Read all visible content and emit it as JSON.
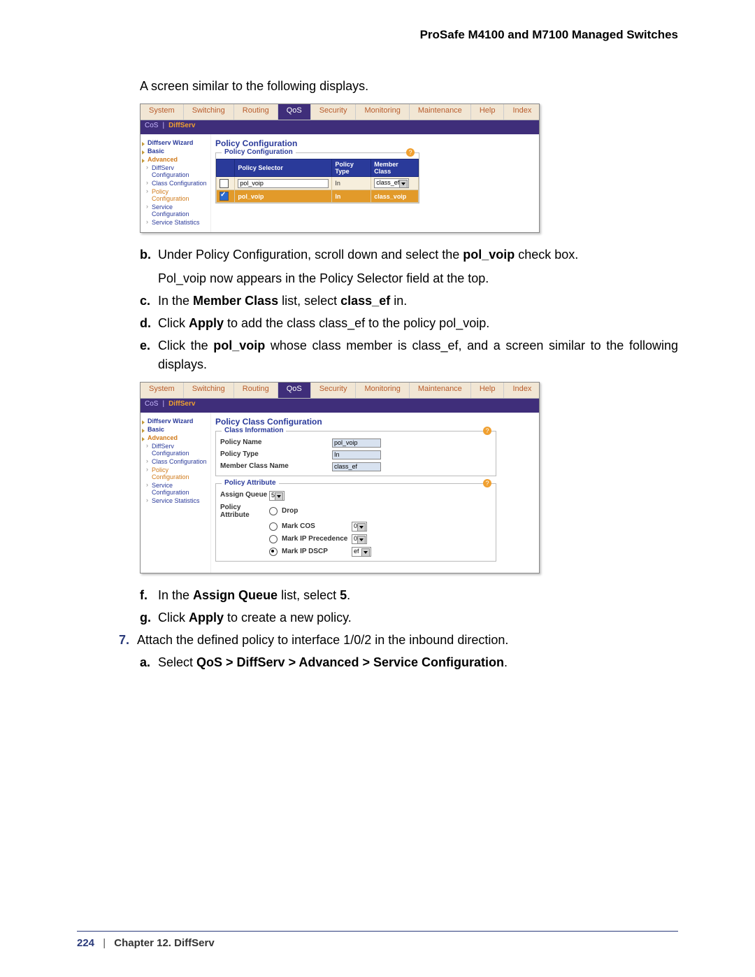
{
  "header_title": "ProSafe M4100 and M7100 Managed Switches",
  "intro_text": "A screen similar to the following displays.",
  "tabs": [
    "System",
    "Switching",
    "Routing",
    "QoS",
    "Security",
    "Monitoring",
    "Maintenance",
    "Help",
    "Index"
  ],
  "active_tab": "QoS",
  "subtabs": [
    "CoS",
    "DiffServ"
  ],
  "active_subtab": "DiffServ",
  "sidebar": {
    "items": [
      "Diffserv Wizard",
      "Basic",
      "Advanced"
    ],
    "sub_items": [
      "DiffServ Configuration",
      "Class Configuration",
      "Policy Configuration",
      "Service Configuration",
      "Service Statistics"
    ]
  },
  "shot1": {
    "panel_title": "Policy Configuration",
    "box_legend": "Policy Configuration",
    "headers": [
      "",
      "Policy Selector",
      "Policy Type",
      "Member Class"
    ],
    "row_input": {
      "policy_selector": "pol_voip",
      "policy_type": "In",
      "member_class": "class_ef"
    },
    "row_selected": {
      "policy_selector": "pol_voip",
      "policy_type": "In",
      "member_class": "class_voip"
    }
  },
  "steps_b_to_e": {
    "b1": "Under Policy Configuration, scroll down and select the ",
    "b1_bold": "pol_voip",
    "b1_tail": " check box.",
    "b2": "Pol_voip now appears in the Policy Selector field at the top.",
    "c_pre": "In the ",
    "c_bold1": "Member Class",
    "c_mid": " list, select ",
    "c_bold2": "class_ef",
    "c_tail": " in.",
    "d_pre": "Click ",
    "d_bold": "Apply",
    "d_tail": " to add the class class_ef to the policy pol_voip.",
    "e_pre": "Click the ",
    "e_bold": "pol_voip",
    "e_tail": " whose class member is class_ef, and a screen similar to the following displays."
  },
  "shot2": {
    "panel_title": "Policy Class Configuration",
    "box1_legend": "Class Information",
    "box2_legend": "Policy Attribute",
    "info": {
      "policy_name_lbl": "Policy Name",
      "policy_name_val": "pol_voip",
      "policy_type_lbl": "Policy Type",
      "policy_type_val": "In",
      "member_lbl": "Member Class Name",
      "member_val": "class_ef"
    },
    "attr": {
      "assign_queue_lbl": "Assign Queue",
      "assign_queue_val": "5",
      "policy_attr_lbl": "Policy Attribute",
      "drop": "Drop",
      "mark_cos": "Mark COS",
      "mark_cos_val": "0",
      "mark_ip_prec": "Mark IP Precedence",
      "mark_ip_prec_val": "0",
      "mark_ip_dscp": "Mark IP DSCP",
      "mark_ip_dscp_val": "ef"
    }
  },
  "steps_f_on": {
    "f_pre": "In the ",
    "f_bold1": "Assign Queue",
    "f_mid": " list, select ",
    "f_bold2": "5",
    "f_tail": ".",
    "g_pre": "Click ",
    "g_bold": "Apply",
    "g_tail": " to create a new policy.",
    "s7": "Attach the defined policy to interface 1/0/2 in the inbound direction.",
    "a_pre": "Select ",
    "a_bold": "QoS > DiffServ > Advanced > Service Configuration",
    "a_tail": "."
  },
  "footer": {
    "page": "224",
    "chapter": "Chapter 12.  DiffServ"
  }
}
